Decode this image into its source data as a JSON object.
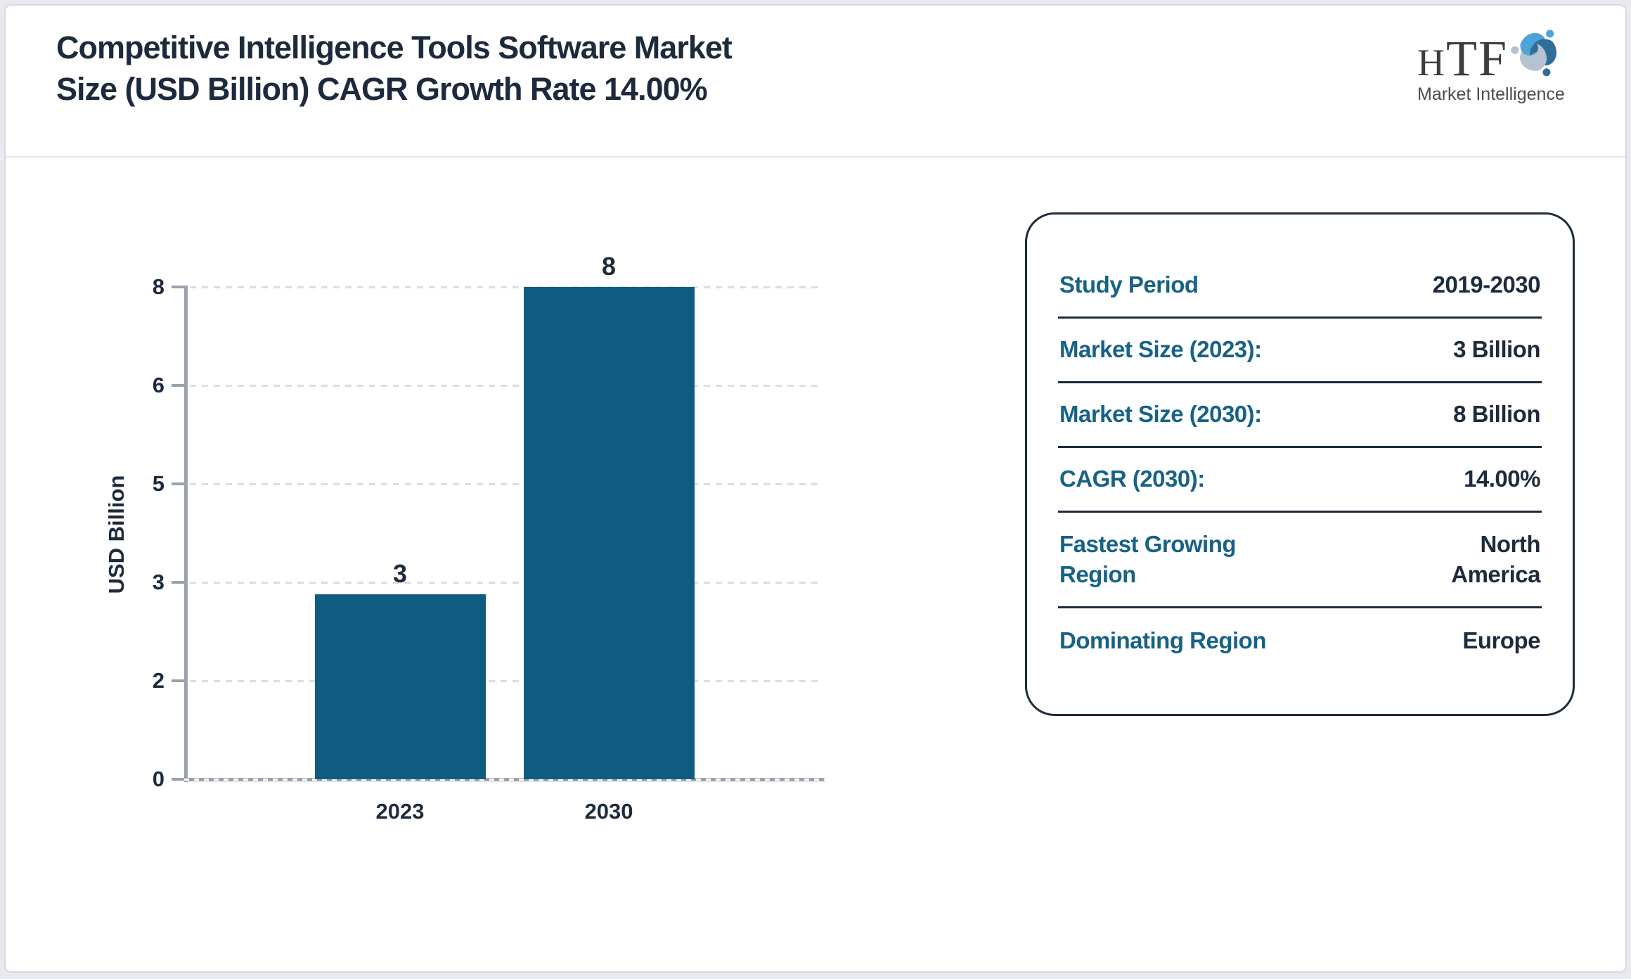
{
  "header": {
    "title_line1": "Competitive Intelligence Tools Software Market",
    "title_line2": "Size (USD Billion) CAGR Growth Rate 14.00%",
    "logo": {
      "letter_h": "H",
      "letters_tf": "TF",
      "subtitle": "Market Intelligence"
    }
  },
  "chart_data": {
    "type": "bar",
    "title": "Competitive Intelligence Tools Software Market Size (USD Billion) CAGR Growth Rate 14.00%",
    "categories": [
      "2023",
      "2030"
    ],
    "values": [
      3,
      8
    ],
    "value_labels": [
      "3",
      "8"
    ],
    "draw_values": [
      2.88,
      8
    ],
    "xlabel": "",
    "ylabel": "USD Billion",
    "y_ticks": [
      0,
      2,
      3,
      5,
      6,
      8
    ],
    "ylim": [
      0,
      8
    ],
    "grid": "horizontal-dashed",
    "legend": "none",
    "bar_color": "#0e5c80"
  },
  "summary": {
    "rows": [
      {
        "label": "Study Period",
        "value": "2019-2030"
      },
      {
        "label": "Market Size (2023):",
        "value": "3 Billion"
      },
      {
        "label": "Market Size (2030):",
        "value": "8 Billion"
      },
      {
        "label": "CAGR (2030):",
        "value": "14.00%"
      },
      {
        "label": "Fastest Growing Region",
        "value": "North America"
      },
      {
        "label": "Dominating Region",
        "value": "Europe"
      }
    ]
  },
  "colors": {
    "bar": "#0e5c80",
    "label_teal": "#176286",
    "navy": "#1e2b3c",
    "axis_gray": "#9aa2ac",
    "logo_light_blue": "#4fa3d8",
    "logo_dark_blue": "#316d99",
    "logo_gray_blue": "#b4c3cf"
  }
}
